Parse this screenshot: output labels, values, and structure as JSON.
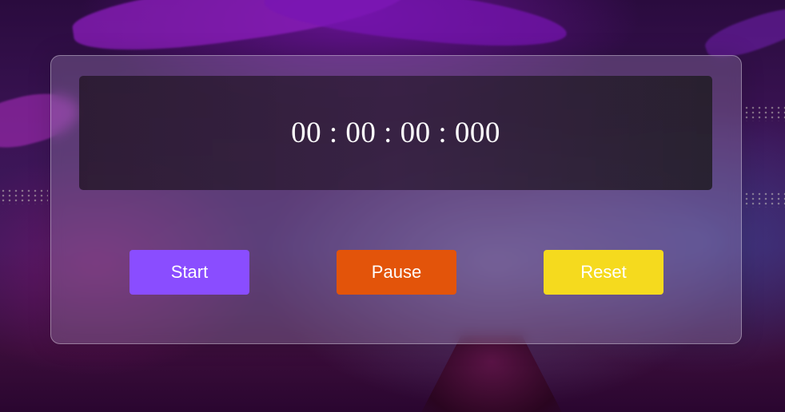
{
  "stopwatch": {
    "time": "00 : 00 : 00 : 000",
    "buttons": {
      "start_label": "Start",
      "pause_label": "Pause",
      "reset_label": "Reset"
    }
  },
  "colors": {
    "start": "#8a4dff",
    "pause": "#e3540a",
    "reset": "#f5da1e"
  }
}
